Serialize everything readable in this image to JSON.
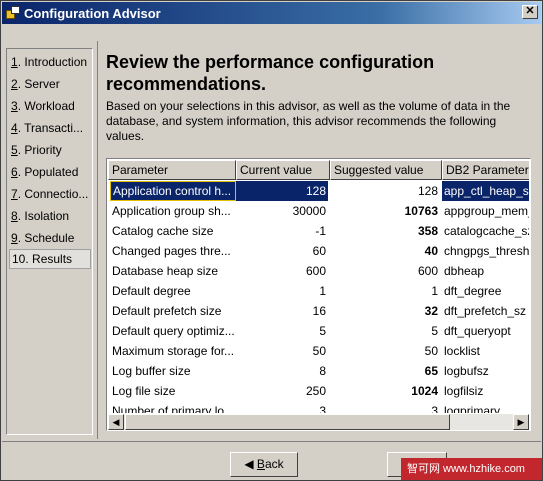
{
  "window": {
    "title": "Configuration Advisor"
  },
  "sidebar": {
    "items": [
      {
        "num": "1",
        "label": ". Introduction"
      },
      {
        "num": "2",
        "label": ". Server"
      },
      {
        "num": "3",
        "label": ". Workload"
      },
      {
        "num": "4",
        "label": ". Transacti..."
      },
      {
        "num": "5",
        "label": ". Priority"
      },
      {
        "num": "6",
        "label": ". Populated"
      },
      {
        "num": "7",
        "label": ". Connectio..."
      },
      {
        "num": "8",
        "label": ". Isolation"
      },
      {
        "num": "9",
        "label": ". Schedule"
      },
      {
        "num": "10",
        "label": ". Results"
      }
    ]
  },
  "main": {
    "heading": "Review the performance configuration recommendations.",
    "description": "Based on your selections in this advisor, as well as the volume of data in the database, and system information, this advisor recommends the following values."
  },
  "table": {
    "columns": [
      "Parameter",
      "Current value",
      "Suggested value",
      "DB2 Parameter"
    ],
    "rows": [
      {
        "param": "Application control h...",
        "current": "128",
        "suggested": "128",
        "db2": "app_ctl_heap_sz"
      },
      {
        "param": "Application group sh...",
        "current": "30000",
        "suggested": "10763",
        "db2": "appgroup_mem_sz"
      },
      {
        "param": "Catalog cache size",
        "current": "-1",
        "suggested": "358",
        "db2": "catalogcache_sz"
      },
      {
        "param": "Changed pages thre...",
        "current": "60",
        "suggested": "40",
        "db2": "chngpgs_thresh"
      },
      {
        "param": "Database heap size",
        "current": "600",
        "suggested": "600",
        "db2": "dbheap"
      },
      {
        "param": "Default degree",
        "current": "1",
        "suggested": "1",
        "db2": "dft_degree"
      },
      {
        "param": "Default prefetch size",
        "current": "16",
        "suggested": "32",
        "db2": "dft_prefetch_sz"
      },
      {
        "param": "Default query optimiz...",
        "current": "5",
        "suggested": "5",
        "db2": "dft_queryopt"
      },
      {
        "param": "Maximum storage for...",
        "current": "50",
        "suggested": "50",
        "db2": "locklist"
      },
      {
        "param": "Log buffer size",
        "current": "8",
        "suggested": "65",
        "db2": "logbufsz"
      },
      {
        "param": "Log file size",
        "current": "250",
        "suggested": "1024",
        "db2": "logfilsiz"
      },
      {
        "param": "Number of primary lo...",
        "current": "3",
        "suggested": "3",
        "db2": "logprimary"
      }
    ]
  },
  "buttons": {
    "back": "Back",
    "back_mnemonic": "B"
  },
  "watermark": "智可网 www.hzhike.com"
}
